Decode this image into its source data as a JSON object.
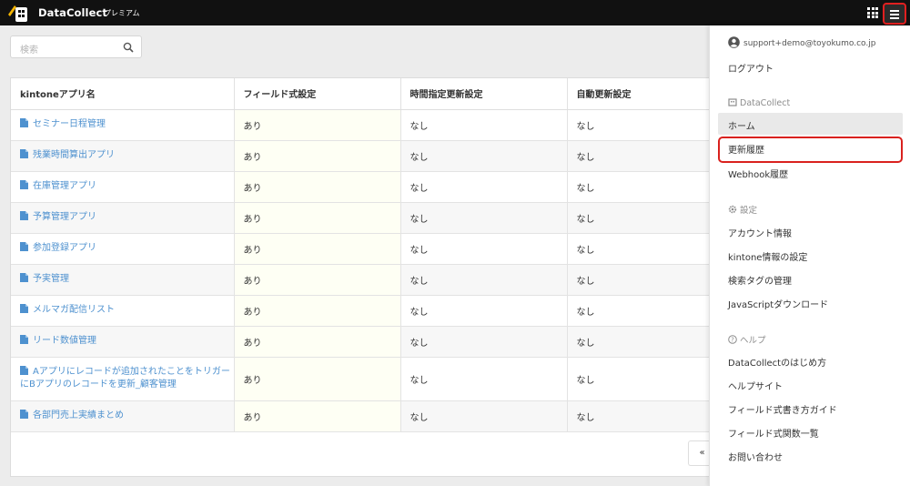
{
  "header": {
    "brand": "DataCollect",
    "plan": "プレミアム"
  },
  "search": {
    "placeholder": "検索"
  },
  "table": {
    "columns": [
      "kintoneアプリ名",
      "フィールド式設定",
      "時間指定更新設定",
      "自動更新設定"
    ],
    "rows": [
      [
        "セミナー日程管理",
        "あり",
        "なし",
        "なし"
      ],
      [
        "残業時間算出アプリ",
        "あり",
        "なし",
        "なし"
      ],
      [
        "在庫管理アプリ",
        "あり",
        "なし",
        "なし"
      ],
      [
        "予算管理アプリ",
        "あり",
        "なし",
        "なし"
      ],
      [
        "参加登録アプリ",
        "あり",
        "なし",
        "なし"
      ],
      [
        "予実管理",
        "あり",
        "なし",
        "なし"
      ],
      [
        "メルマガ配信リスト",
        "あり",
        "なし",
        "なし"
      ],
      [
        "リード数値管理",
        "あり",
        "なし",
        "なし"
      ],
      [
        "Aアプリにレコードが追加されたことをトリガーにBアプリのレコードを更新_顧客管理",
        "あり",
        "なし",
        "なし"
      ],
      [
        "各部門売上実績まとめ",
        "あり",
        "なし",
        "なし"
      ]
    ]
  },
  "pagination": {
    "prev": "«"
  },
  "drawer": {
    "user_email": "support+demo@toyokumo.co.jp",
    "logout": "ログアウト",
    "section_app": "DataCollect",
    "home": "ホーム",
    "history": "更新履歴",
    "webhook_history": "Webhook履歴",
    "section_settings": "設定",
    "account": "アカウント情報",
    "kintone_settings": "kintone情報の設定",
    "tags": "検索タグの管理",
    "js_download": "JavaScriptダウンロード",
    "section_help": "ヘルプ",
    "getting_started": "DataCollectのはじめ方",
    "help_site": "ヘルプサイト",
    "field_guide": "フィールド式書き方ガイド",
    "functions": "フィールド式関数一覧",
    "contact": "お問い合わせ"
  },
  "colors": {
    "link": "#4e91cf",
    "highlight": "#d9211e",
    "header_bg": "#111111"
  }
}
